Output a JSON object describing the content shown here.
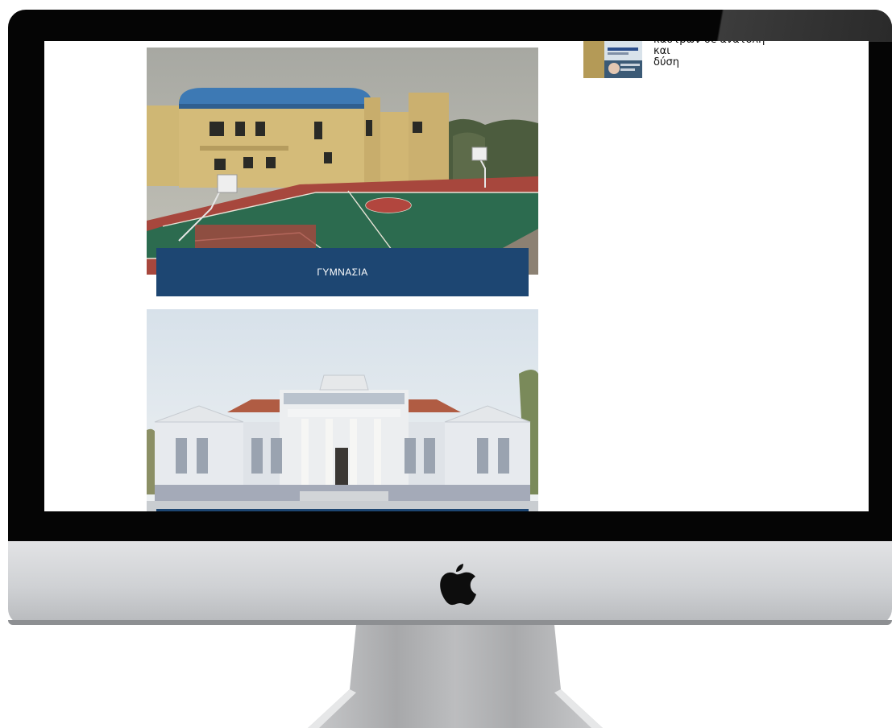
{
  "sidebar_post": {
    "title_line1": "κάστρων σε ανατολή και",
    "title_line2": "δύση"
  },
  "cards": [
    {
      "caption": "ΓΥΜΝΑΣΙΑ"
    },
    {
      "caption": ""
    }
  ],
  "colors": {
    "caption_bg": "#1d4672",
    "caption_text": "#ffffff",
    "bezel": "#050505",
    "chin": "#cfd1d4"
  },
  "icons": {
    "brand": "apple-logo-icon"
  }
}
